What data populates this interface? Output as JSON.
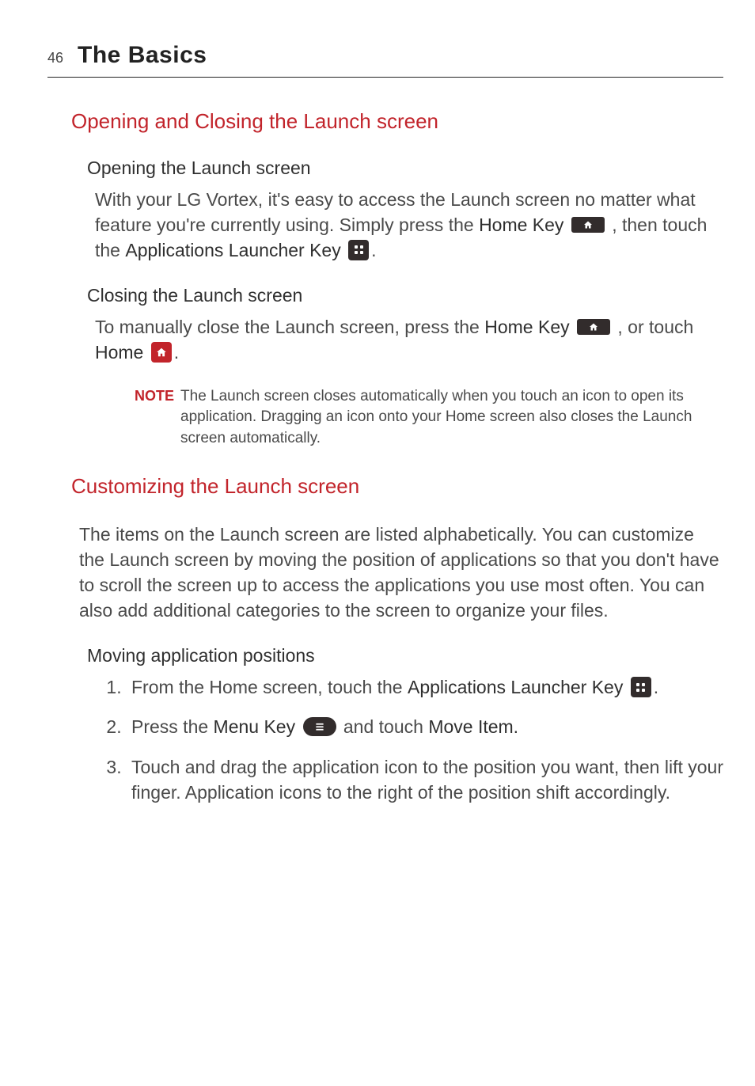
{
  "page_number": "46",
  "section_title": "The Basics",
  "h1_a": "Opening and Closing the Launch screen",
  "open_sub": "Opening the Launch screen",
  "open_text_1": "With your LG Vortex, it's easy to access the Launch screen no matter what feature you're currently using. Simply press the ",
  "home_key_label": "Home Key",
  "open_text_2": " , then touch the ",
  "app_launcher_label": "Applications Launcher Key",
  "period": ".",
  "close_sub": "Closing the Launch screen",
  "close_text_1": "To manually close the Launch screen, press the ",
  "close_text_2": " , or touch ",
  "home_label": "Home",
  "note_label": "NOTE",
  "note_text": "The Launch screen closes automatically when you touch an icon to open its application. Dragging an icon onto your Home screen also closes the Launch screen automatically.",
  "h1_b": "Customizing the Launch screen",
  "customize_intro": "The items on the Launch screen are listed alphabetically. You can customize the Launch screen by moving the position of applications so that you don't have to scroll the screen up to access the applications you use most often. You can also add additional categories to the screen to organize your files.",
  "moving_sub": "Moving application positions",
  "step1_a": "From the Home screen, touch the ",
  "step1_b": "Applications Launcher Key",
  "step2_a": "Press the ",
  "menu_key_label": "Menu Key",
  "step2_b": "  and touch ",
  "move_item_label": "Move Item.",
  "step3": "Touch and drag the application icon to the position you want, then lift your finger. Application icons to the right of the position shift accordingly."
}
